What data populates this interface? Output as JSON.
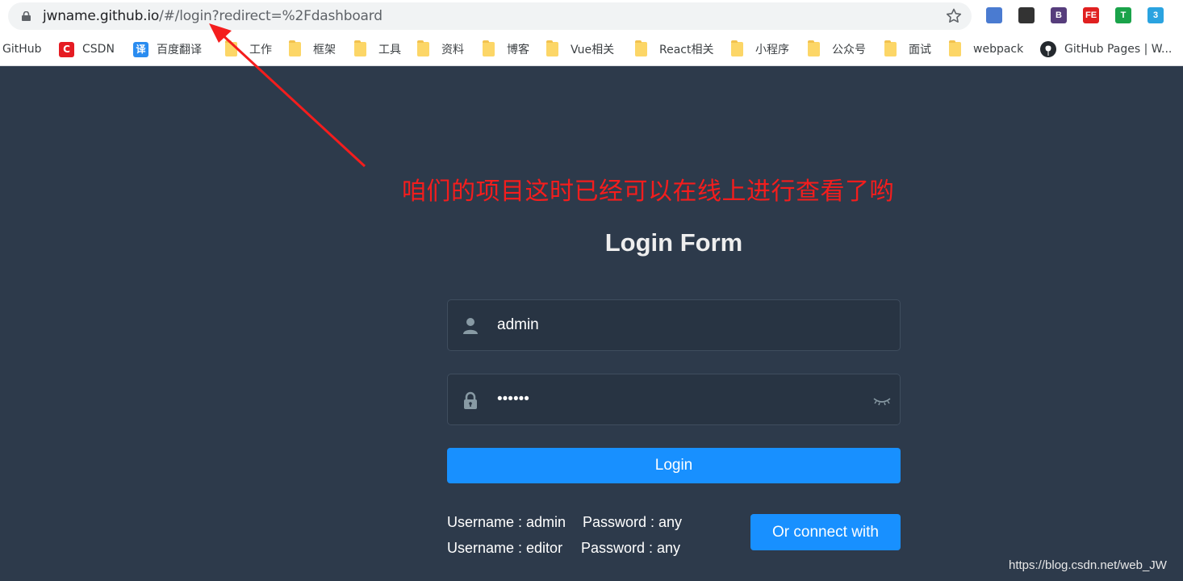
{
  "browser": {
    "url_host": "jwname.github.io",
    "url_path": "/#/login?redirect=%2Fdashboard",
    "bookmarks": [
      {
        "label": "GitHub",
        "icon": "none"
      },
      {
        "label": "CSDN",
        "icon": "csdn-icon"
      },
      {
        "label": "百度翻译",
        "icon": "translate-icon"
      },
      {
        "label": "工作",
        "icon": "folder-icon"
      },
      {
        "label": "框架",
        "icon": "folder-icon"
      },
      {
        "label": "工具",
        "icon": "folder-icon"
      },
      {
        "label": "资料",
        "icon": "folder-icon"
      },
      {
        "label": "博客",
        "icon": "folder-icon"
      },
      {
        "label": "Vue相关",
        "icon": "folder-icon"
      },
      {
        "label": "React相关",
        "icon": "folder-icon"
      },
      {
        "label": "小程序",
        "icon": "folder-icon"
      },
      {
        "label": "公众号",
        "icon": "folder-icon"
      },
      {
        "label": "面试",
        "icon": "folder-icon"
      },
      {
        "label": "webpack",
        "icon": "folder-icon"
      },
      {
        "label": "GitHub Pages | W...",
        "icon": "github-icon"
      }
    ],
    "extensions": [
      {
        "name": "translate-extension-icon",
        "color": "#4a7bd1",
        "glyph": ""
      },
      {
        "name": "qrcode-extension-icon",
        "color": "#333333",
        "glyph": ""
      },
      {
        "name": "bootstrap-extension-icon",
        "color": "#563d7c",
        "glyph": "B"
      },
      {
        "name": "fe-helper-extension-icon",
        "color": "#e02020",
        "glyph": "FE"
      },
      {
        "name": "shield-extension-icon",
        "color": "#1aa34a",
        "glyph": "T"
      },
      {
        "name": "css-extension-icon",
        "color": "#2aa3e0",
        "glyph": "3"
      }
    ]
  },
  "annotation": "咱们的项目这时已经可以在线上进行查看了哟",
  "login": {
    "title": "Login Form",
    "username_value": "admin",
    "password_masked": "••••••",
    "login_label": "Login",
    "tips": [
      {
        "user": "Username : admin",
        "pass": "Password : any"
      },
      {
        "user": "Username : editor",
        "pass": "Password : any"
      }
    ],
    "connect_label": "Or connect with"
  },
  "watermark": "https://blog.csdn.net/web_JW",
  "colors": {
    "page_bg": "#2d3a4b",
    "accent": "#1890ff",
    "annotation": "#f41d1d"
  }
}
